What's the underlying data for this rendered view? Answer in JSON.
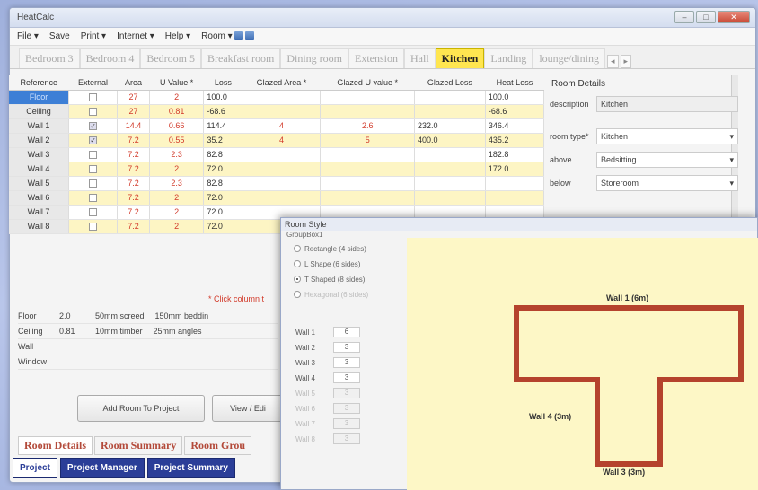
{
  "window": {
    "title": "HeatCalc",
    "controls": {
      "minimize": "–",
      "maximize": "□",
      "close": "✕"
    }
  },
  "menu": [
    {
      "label": "File ▾"
    },
    {
      "label": "Save"
    },
    {
      "label": "Print ▾"
    },
    {
      "label": "Internet ▾"
    },
    {
      "label": "Help ▾"
    },
    {
      "label": "Room ▾"
    }
  ],
  "room_tabs": [
    {
      "label": "Bedroom 3"
    },
    {
      "label": "Bedroom 4"
    },
    {
      "label": "Bedroom 5"
    },
    {
      "label": "Breakfast room"
    },
    {
      "label": "Dining room"
    },
    {
      "label": "Extension"
    },
    {
      "label": "Hall"
    },
    {
      "label": "Kitchen",
      "active": true
    },
    {
      "label": "Landing"
    },
    {
      "label": "lounge/dining"
    }
  ],
  "table": {
    "headers": [
      "Reference",
      "External",
      "Area",
      "U Value *",
      "Loss",
      "Glazed Area *",
      "Glazed U value *",
      "Glazed Loss",
      "Heat Loss"
    ],
    "rows": [
      {
        "ref": "Floor",
        "ext": false,
        "area": "27",
        "u": "2",
        "loss": "100.0",
        "garea": "",
        "gu": "",
        "gloss": "",
        "heat": "100.0"
      },
      {
        "ref": "Ceiling",
        "ext": false,
        "area": "27",
        "u": "0.81",
        "loss": "-68.6",
        "garea": "",
        "gu": "",
        "gloss": "",
        "heat": "-68.6"
      },
      {
        "ref": "Wall 1",
        "ext": true,
        "area": "14.4",
        "u": "0.66",
        "loss": "114.4",
        "garea": "4",
        "gu": "2.6",
        "gloss": "232.0",
        "heat": "346.4"
      },
      {
        "ref": "Wall 2",
        "ext": true,
        "area": "7.2",
        "u": "0.55",
        "loss": "35.2",
        "garea": "4",
        "gu": "5",
        "gloss": "400.0",
        "heat": "435.2"
      },
      {
        "ref": "Wall 3",
        "ext": false,
        "area": "7.2",
        "u": "2.3",
        "loss": "82.8",
        "garea": "",
        "gu": "",
        "gloss": "",
        "heat": "182.8"
      },
      {
        "ref": "Wall 4",
        "ext": false,
        "area": "7.2",
        "u": "2",
        "loss": "72.0",
        "garea": "",
        "gu": "",
        "gloss": "",
        "heat": "172.0"
      },
      {
        "ref": "Wall 5",
        "ext": false,
        "area": "7.2",
        "u": "2.3",
        "loss": "82.8",
        "garea": "",
        "gu": "",
        "gloss": "",
        "heat": ""
      },
      {
        "ref": "Wall 6",
        "ext": false,
        "area": "7.2",
        "u": "2",
        "loss": "72.0",
        "garea": "",
        "gu": "",
        "gloss": "",
        "heat": ""
      },
      {
        "ref": "Wall 7",
        "ext": false,
        "area": "7.2",
        "u": "2",
        "loss": "72.0",
        "garea": "",
        "gu": "",
        "gloss": "",
        "heat": ""
      },
      {
        "ref": "Wall 8",
        "ext": false,
        "area": "7.2",
        "u": "2",
        "loss": "72.0",
        "garea": "",
        "gu": "",
        "gloss": "",
        "heat": ""
      }
    ]
  },
  "click_note": "* Click column t",
  "fabric": [
    {
      "label": "Floor",
      "val": "2.0",
      "a": "50mm screed",
      "b": "150mm beddin"
    },
    {
      "label": "Ceiling",
      "val": "0.81",
      "a": "10mm timber",
      "b": "25mm angles"
    },
    {
      "label": "Wall",
      "val": "",
      "a": "",
      "b": ""
    },
    {
      "label": "Window",
      "val": "",
      "a": "",
      "b": ""
    }
  ],
  "buttons": {
    "add_room": "Add Room To Project",
    "view": "View / Edi"
  },
  "lower_tabs": [
    "Room Details",
    "Room Summary",
    "Room Grou"
  ],
  "project_tabs": [
    "Project",
    "Project Manager",
    "Project Summary"
  ],
  "room_details": {
    "title": "Room Details",
    "description_label": "description",
    "description_value": "Kitchen",
    "room_type_label": "room type*",
    "room_type_value": "Kitchen",
    "above_label": "above",
    "above_value": "Bedsitting",
    "below_label": "below",
    "below_value": "Storeroom"
  },
  "room_style": {
    "title": "Room Style",
    "group_label": "GroupBox1",
    "shapes": [
      {
        "label": "Rectangle (4 sides)",
        "selected": false,
        "disabled": false
      },
      {
        "label": "L Shape (6 sides)",
        "selected": false,
        "disabled": false
      },
      {
        "label": "T Shaped (8 sides)",
        "selected": true,
        "disabled": false
      },
      {
        "label": "Hexagonal (6 sides)",
        "selected": false,
        "disabled": true
      }
    ],
    "walls": [
      {
        "label": "Wall 1",
        "value": "6",
        "disabled": false
      },
      {
        "label": "Wall 2",
        "value": "3",
        "disabled": false
      },
      {
        "label": "Wall 3",
        "value": "3",
        "disabled": false
      },
      {
        "label": "Wall 4",
        "value": "3",
        "disabled": false
      },
      {
        "label": "Wall 5",
        "value": "3",
        "disabled": true
      },
      {
        "label": "Wall 6",
        "value": "3",
        "disabled": true
      },
      {
        "label": "Wall 7",
        "value": "3",
        "disabled": true
      },
      {
        "label": "Wall 8",
        "value": "3",
        "disabled": true
      }
    ],
    "diagram_labels": {
      "wall1": "Wall 1 (6m)",
      "wall4": "Wall 4 (3m)",
      "wall3": "Wall 3 (3m)"
    },
    "outline_color": "#b5432d"
  }
}
